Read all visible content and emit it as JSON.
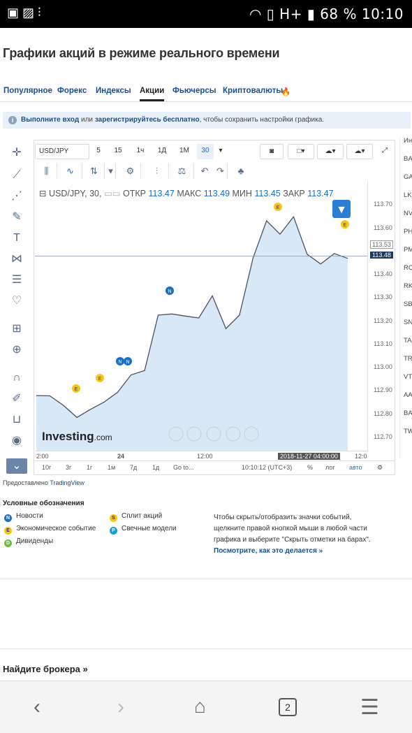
{
  "status": {
    "battery": "68 %",
    "time": "10:10",
    "network": "H+"
  },
  "page_title": "Графики акций в режиме реального времени",
  "tabs": [
    {
      "label": "Популярное"
    },
    {
      "label": "Форекс"
    },
    {
      "label": "Индексы"
    },
    {
      "label": "Акции"
    },
    {
      "label": "Фьючерсы"
    },
    {
      "label": "Криптовалюты"
    }
  ],
  "notice": {
    "link1": "Выполните вход",
    "mid": " или ",
    "link2": "зарегистрируйтесь бесплатно",
    "tail": ", чтобы сохранить настройки графика."
  },
  "toolbar": {
    "symbol": "USD/JPY",
    "intervals": [
      "5",
      "15",
      "1ч",
      "1Д",
      "1М",
      "30"
    ]
  },
  "legend": {
    "symbol": "USD/JPY, 30,",
    "open_label": "ОТКР",
    "open": "113.47",
    "high_label": "МАКС",
    "high": "113.49",
    "low_label": "МИН",
    "low": "113.45",
    "close_label": "ЗАКР",
    "close": "113.47"
  },
  "yaxis": [
    "113.70",
    "113.60",
    "113.53",
    "113.48",
    "113.40",
    "113.30",
    "113.20",
    "113.10",
    "113.00",
    "112.90",
    "112.80",
    "112.70"
  ],
  "xaxis": [
    "2:00",
    "24",
    "12:00",
    "2018-11-27 04:00:00",
    "12:0"
  ],
  "bottom": {
    "ranges": [
      "10г",
      "3г",
      "1г",
      "1м",
      "7д",
      "1д",
      "Go to..."
    ],
    "time": "10:10:12 (UTC+3)",
    "pct": "%",
    "log": "лог",
    "auto": "авто"
  },
  "watermark": "Investing",
  "watermark_suffix": ".com",
  "right_col": [
    "Ин",
    "BA",
    "GA",
    "LK",
    "NV",
    "PH",
    "PM",
    "RO",
    "RK",
    "SB",
    "SN",
    "TA",
    "TR",
    "VT",
    "AA",
    "BA",
    "TW"
  ],
  "provided": {
    "prefix": "Предоставлено ",
    "link": "TradingView"
  },
  "legend_block": {
    "title": "Условные обозначения",
    "news": "Новости",
    "econ": "Экономическое событие",
    "div": "Дивиденды",
    "split": "Сплит акций",
    "candle": "Свечные модели"
  },
  "hint": {
    "text": "Чтобы скрыть/отобразить значки событий, щелкните правой кнопкой мыши в любой части графика и выберите \"Скрыть отметки на барах\".",
    "link": "Посмотрите, как это делается »"
  },
  "broker": "Найдите брокера »",
  "nav": {
    "tabs_count": "2"
  },
  "colors": {
    "line": "#4a5263",
    "area": "#d9e8f6",
    "blue": "#1a6fc6"
  },
  "chart_data": {
    "type": "area",
    "symbol": "USD/JPY",
    "interval": "30",
    "x": [
      "2:00",
      "",
      "",
      "",
      "",
      "",
      "",
      "24",
      "",
      "",
      "",
      "",
      "",
      "",
      "12:00",
      "",
      "",
      "",
      "",
      "",
      "",
      "",
      "2018-11-27 04:00:00",
      "12:0"
    ],
    "values": [
      112.88,
      112.87,
      112.85,
      112.78,
      112.83,
      112.84,
      112.9,
      112.96,
      113.0,
      113.22,
      113.24,
      113.21,
      113.22,
      113.3,
      113.18,
      113.22,
      113.48,
      113.62,
      113.58,
      113.64,
      113.5,
      113.44,
      113.5,
      113.47
    ],
    "ylim": [
      112.64,
      113.8
    ]
  }
}
